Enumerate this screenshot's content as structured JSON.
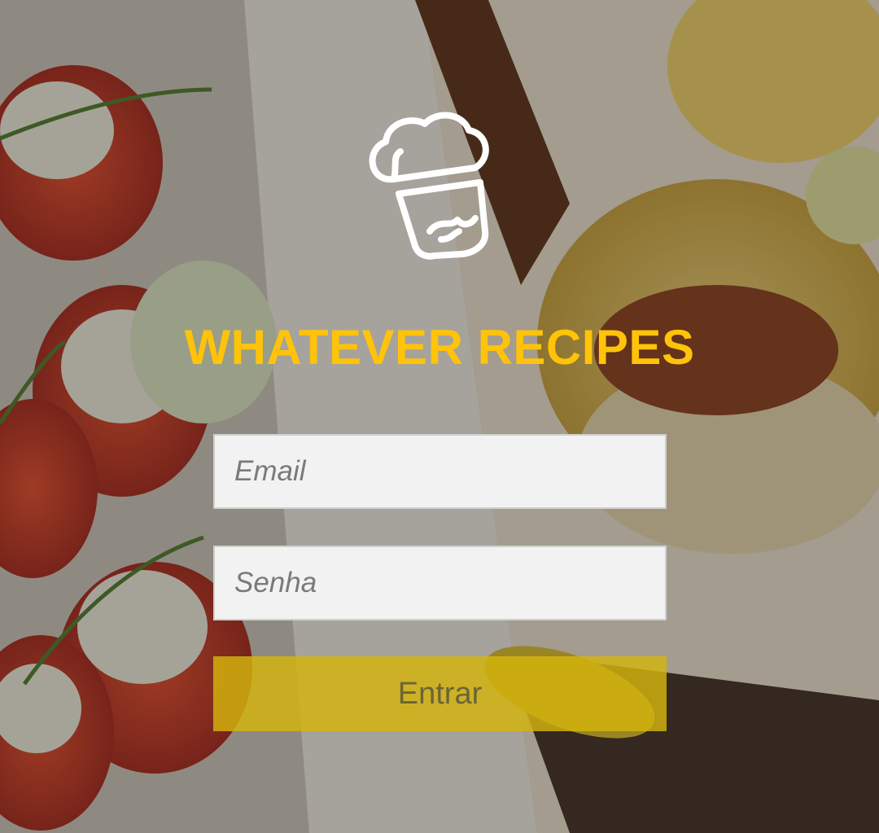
{
  "app": {
    "title": "WHATEVER RECIPES",
    "logo_icon": "chef-hat-icon",
    "accent_color": "#ffc30a"
  },
  "form": {
    "email_placeholder": "Email",
    "password_placeholder": "Senha",
    "submit_label": "Entrar",
    "button_color": "#d4b40e"
  },
  "background": {
    "description_icon": "food-photo-background"
  }
}
